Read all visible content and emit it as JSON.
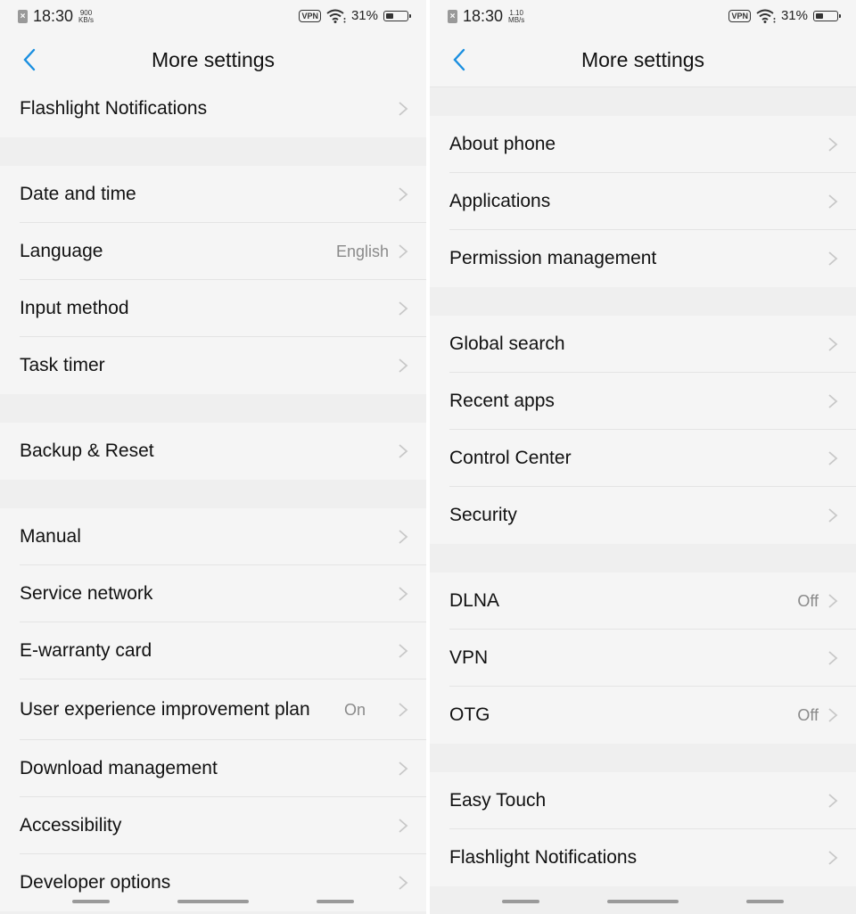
{
  "left_screen": {
    "status": {
      "time": "18:30",
      "speed_value": "900",
      "speed_unit": "KB/s",
      "vpn": "VPN",
      "battery_pct": "31%",
      "battery_level": 0.31
    },
    "header": {
      "title": "More settings"
    },
    "items": [
      {
        "label": "Flashlight Notifications",
        "value": ""
      },
      {
        "label": "Date and time",
        "value": ""
      },
      {
        "label": "Language",
        "value": "English"
      },
      {
        "label": "Input method",
        "value": ""
      },
      {
        "label": "Task timer",
        "value": ""
      },
      {
        "label": "Backup & Reset",
        "value": ""
      },
      {
        "label": "Manual",
        "value": ""
      },
      {
        "label": "Service network",
        "value": ""
      },
      {
        "label": "E-warranty card",
        "value": ""
      },
      {
        "label": "User experience improvement plan",
        "value": "On"
      },
      {
        "label": "Download management",
        "value": ""
      },
      {
        "label": "Accessibility",
        "value": ""
      },
      {
        "label": "Developer options",
        "value": ""
      }
    ]
  },
  "right_screen": {
    "status": {
      "time": "18:30",
      "speed_value": "1.10",
      "speed_unit": "MB/s",
      "vpn": "VPN",
      "battery_pct": "31%",
      "battery_level": 0.31
    },
    "header": {
      "title": "More settings"
    },
    "items": [
      {
        "label": "About phone",
        "value": ""
      },
      {
        "label": "Applications",
        "value": ""
      },
      {
        "label": "Permission management",
        "value": ""
      },
      {
        "label": "Global search",
        "value": ""
      },
      {
        "label": "Recent apps",
        "value": ""
      },
      {
        "label": "Control Center",
        "value": ""
      },
      {
        "label": "Security",
        "value": ""
      },
      {
        "label": "DLNA",
        "value": "Off"
      },
      {
        "label": "VPN",
        "value": ""
      },
      {
        "label": "OTG",
        "value": "Off"
      },
      {
        "label": "Easy Touch",
        "value": ""
      },
      {
        "label": "Flashlight Notifications",
        "value": ""
      }
    ]
  },
  "colors": {
    "accent": "#1a8fe0",
    "background": "#f5f5f5",
    "separator": "#efefef"
  }
}
